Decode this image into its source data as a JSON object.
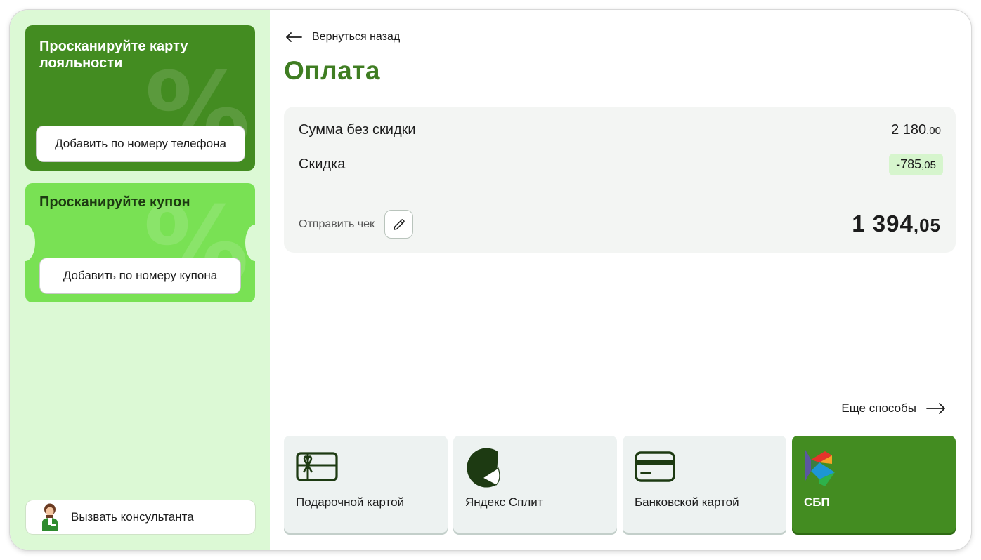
{
  "sidebar": {
    "loyalty_card": {
      "title": "Просканируйте карту лояльности",
      "button_label": "Добавить по номеру телефона",
      "decor": "%"
    },
    "coupon_card": {
      "title": "Просканируйте купон",
      "button_label": "Добавить по номеру купона",
      "decor": "%"
    },
    "consultant_button_label": "Вызвать консультанта"
  },
  "header": {
    "back_label": "Вернуться назад",
    "title": "Оплата"
  },
  "summary": {
    "subtotal_label": "Сумма без скидки",
    "subtotal_rub": "2 180",
    "subtotal_kop": ",00",
    "discount_label": "Скидка",
    "discount_rub": "-785",
    "discount_kop": ",05",
    "send_receipt_label": "Отправить чек",
    "total_rub": "1 394",
    "total_kop": ",05"
  },
  "payment": {
    "more_label": "Еще способы",
    "methods": [
      {
        "label": "Подарочной картой",
        "icon": "gift-card-icon"
      },
      {
        "label": "Яндекс Сплит",
        "icon": "yandex-split-icon"
      },
      {
        "label": "Банковской картой",
        "icon": "bank-card-icon"
      },
      {
        "label": "СБП",
        "icon": "sbp-logo-icon"
      }
    ]
  },
  "colors": {
    "brand_green": "#438c21",
    "title_green": "#3f7d22",
    "light_green": "#79e154",
    "sidebar_bg": "#dcf9d5",
    "discount_bg": "#d6f5cd"
  }
}
